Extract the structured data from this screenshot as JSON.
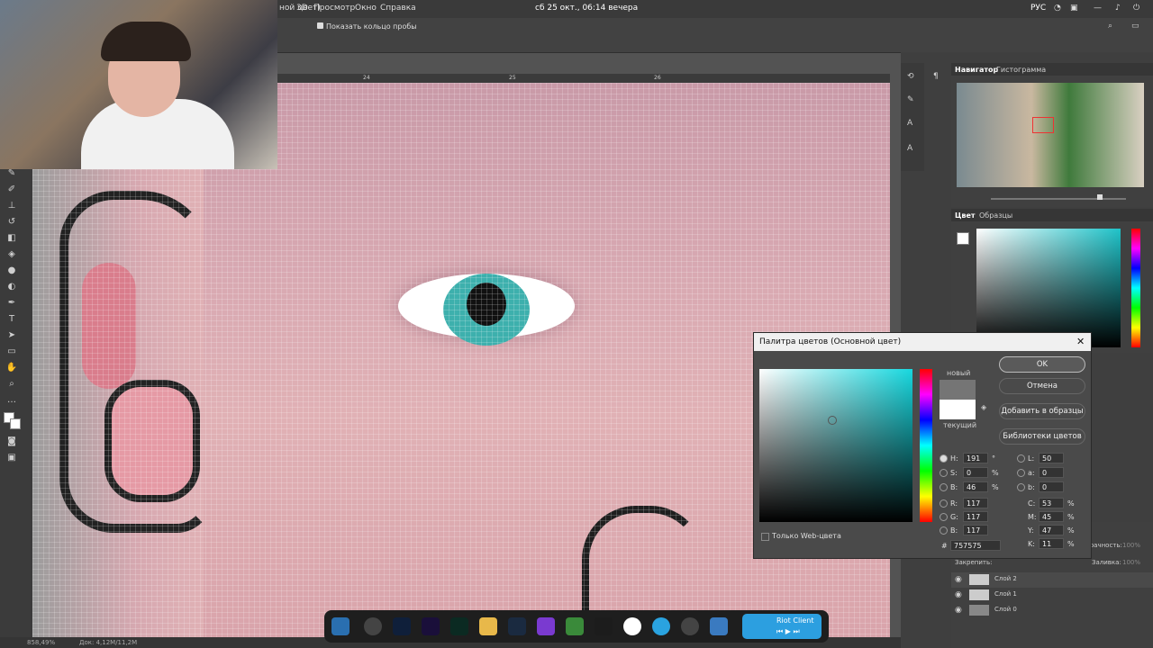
{
  "menubar": {
    "doc_tab": "ной цвет)",
    "items": [
      "3D",
      "Просмотр",
      "Окно",
      "Справка"
    ],
    "datetime": "сб 25 окт., 06:14 вечера",
    "lang": "РУС"
  },
  "options": {
    "show_ring_label": "Показать кольцо пробы"
  },
  "rulers": {
    "top_ticks": [
      "24",
      "25",
      "26"
    ]
  },
  "panels": {
    "navigator_tabs": [
      "Навигатор",
      "Гистограмма"
    ],
    "color_tabs": [
      "Цвет",
      "Образцы"
    ],
    "layers": {
      "opacity_label": "зрачность:",
      "opacity_value": "100%",
      "lock_label": "Закрепить:",
      "fill_label": "Заливка:",
      "fill_value": "100%",
      "items": [
        "Слой 2",
        "Слой 1",
        "Слой 0"
      ]
    }
  },
  "status": {
    "zoom": "858,49%",
    "doc": "Док: 4,12M/11,2M"
  },
  "dialog": {
    "title": "Палитра цветов (Основной цвет)",
    "new_label": "новый",
    "current_label": "текущий",
    "ok": "OK",
    "cancel": "Отмена",
    "add_swatch": "Добавить в образцы",
    "libraries": "Библиотеки цветов",
    "web_only": "Только Web-цвета",
    "fields": {
      "H": {
        "label": "H:",
        "value": "191",
        "unit": "°"
      },
      "S": {
        "label": "S:",
        "value": "0",
        "unit": "%"
      },
      "B": {
        "label": "B:",
        "value": "46",
        "unit": "%"
      },
      "R": {
        "label": "R:",
        "value": "117"
      },
      "G": {
        "label": "G:",
        "value": "117"
      },
      "Bb": {
        "label": "B:",
        "value": "117"
      },
      "L": {
        "label": "L:",
        "value": "50"
      },
      "a": {
        "label": "a:",
        "value": "0"
      },
      "b": {
        "label": "b:",
        "value": "0"
      },
      "C": {
        "label": "C:",
        "value": "53",
        "unit": "%"
      },
      "M": {
        "label": "M:",
        "value": "45",
        "unit": "%"
      },
      "Y": {
        "label": "Y:",
        "value": "47",
        "unit": "%"
      },
      "K": {
        "label": "K:",
        "value": "11",
        "unit": "%"
      }
    },
    "hex_label": "#",
    "hex_value": "757575"
  },
  "taskbar": {
    "riot_label": "Riot Client"
  },
  "colors": {
    "accent": "#1fc3c9",
    "new_swatch": "#757575",
    "current_swatch": "#ffffff"
  }
}
